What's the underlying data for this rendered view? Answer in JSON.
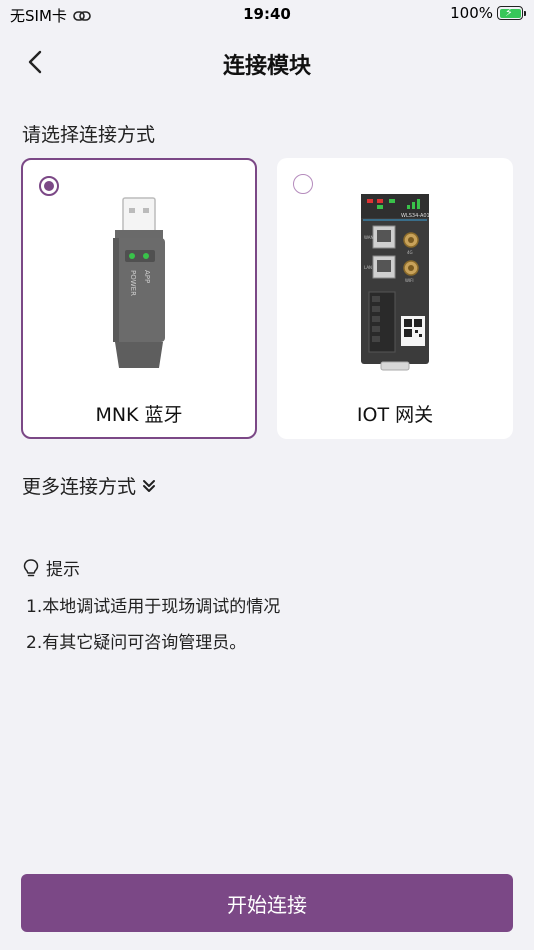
{
  "status_bar": {
    "carrier": "无SIM卡",
    "time": "19:40",
    "battery": "100%"
  },
  "nav": {
    "title": "连接模块",
    "back_icon": "chevron-left-icon"
  },
  "section_label": "请选择连接方式",
  "options": [
    {
      "label": "MNK 蓝牙",
      "selected": true,
      "image": "usb-bluetooth-dongle"
    },
    {
      "label": "IOT 网关",
      "selected": false,
      "image": "iot-gateway-device"
    }
  ],
  "dongle_text": {
    "app": "APP",
    "power": "POWER"
  },
  "gateway_text": {
    "model": "WLS34-A01",
    "port_lan": "LAN",
    "port_wan": "WAN",
    "ant1": "4G",
    "ant2": "WIFI"
  },
  "more_options": "更多连接方式",
  "tips": {
    "header": "提示",
    "items": [
      "1.本地调试适用于现场调试的情况",
      "2.有其它疑问可咨询管理员。"
    ]
  },
  "primary_button": "开始连接",
  "colors": {
    "accent": "#7b4886",
    "background": "#f2f2f6",
    "battery": "#37c759"
  }
}
